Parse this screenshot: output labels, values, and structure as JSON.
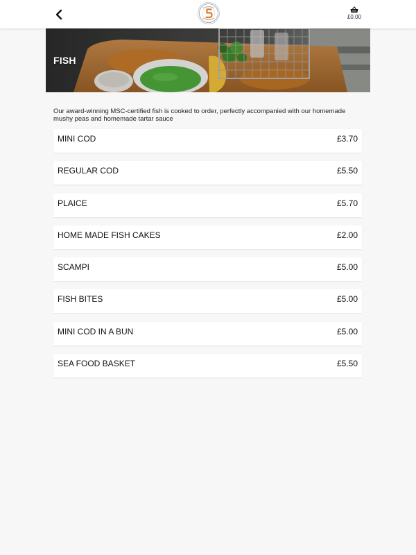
{
  "header": {
    "back_icon": "chevron-left-icon",
    "logo_icon": "shop-logo",
    "basket_icon": "basket-icon",
    "basket_total": "£0.00"
  },
  "hero": {
    "title": "FISH"
  },
  "description": "Our award-winning MSC-certified fish is cooked to order, perfectly accompanied with our homemade mushy peas and homemade tartar sauce",
  "menu": {
    "items": [
      {
        "name": "MINI COD",
        "price": "£3.70"
      },
      {
        "name": "REGULAR COD",
        "price": "£5.50"
      },
      {
        "name": "PLAICE",
        "price": "£5.70"
      },
      {
        "name": "HOME MADE FISH CAKES",
        "price": "£2.00"
      },
      {
        "name": "SCAMPI",
        "price": "£5.00"
      },
      {
        "name": "FISH BITES",
        "price": "£5.00"
      },
      {
        "name": "MINI COD IN A BUN",
        "price": "£5.00"
      },
      {
        "name": "SEA FOOD BASKET",
        "price": "£5.50"
      }
    ]
  },
  "colors": {
    "page_bg": "#f7f7f7",
    "card_bg": "#ffffff",
    "logo_accent": "#e07a2a"
  }
}
